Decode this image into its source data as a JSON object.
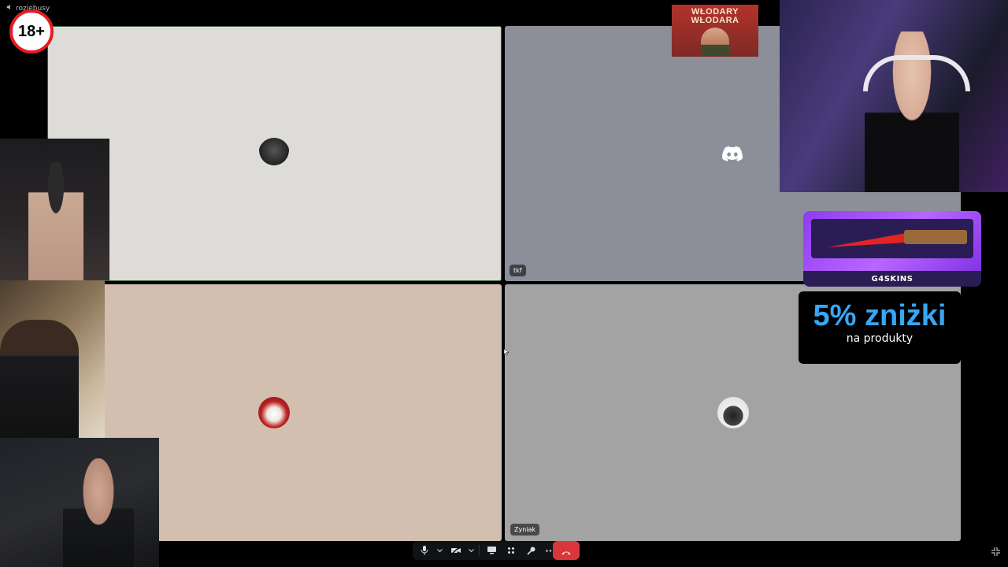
{
  "window": {
    "channel_name": "rozjebusy",
    "channel_icon": "speaker-icon"
  },
  "badge": {
    "age_label": "18+"
  },
  "poster": {
    "title": "WŁODARY WŁODARA"
  },
  "tiles": [
    {
      "id": "t1",
      "avatar": "user-avatar-1",
      "name": ""
    },
    {
      "id": "t2",
      "avatar": "discord-logo-icon",
      "name": "tkf"
    },
    {
      "id": "t3",
      "avatar": "user-avatar-3",
      "name": ""
    },
    {
      "id": "t4",
      "avatar": "user-avatar-4",
      "name": "Zyniak"
    }
  ],
  "promo": {
    "brand": "G4SKINS",
    "discount_text": "5% zniżki",
    "discount_sub": "na produkty"
  },
  "controls": {
    "icons": [
      "mic-icon",
      "chevron-down-icon",
      "camera-off-icon",
      "chevron-down-icon",
      "screen-share-icon",
      "activities-icon",
      "soundboard-icon",
      "more-icon",
      "hangup-icon"
    ]
  },
  "colors": {
    "hangup": "#da373c",
    "discount_text": "#36a7f5",
    "age_badge_ring": "#e31e24",
    "promo_purple": "#8d3cf0"
  }
}
